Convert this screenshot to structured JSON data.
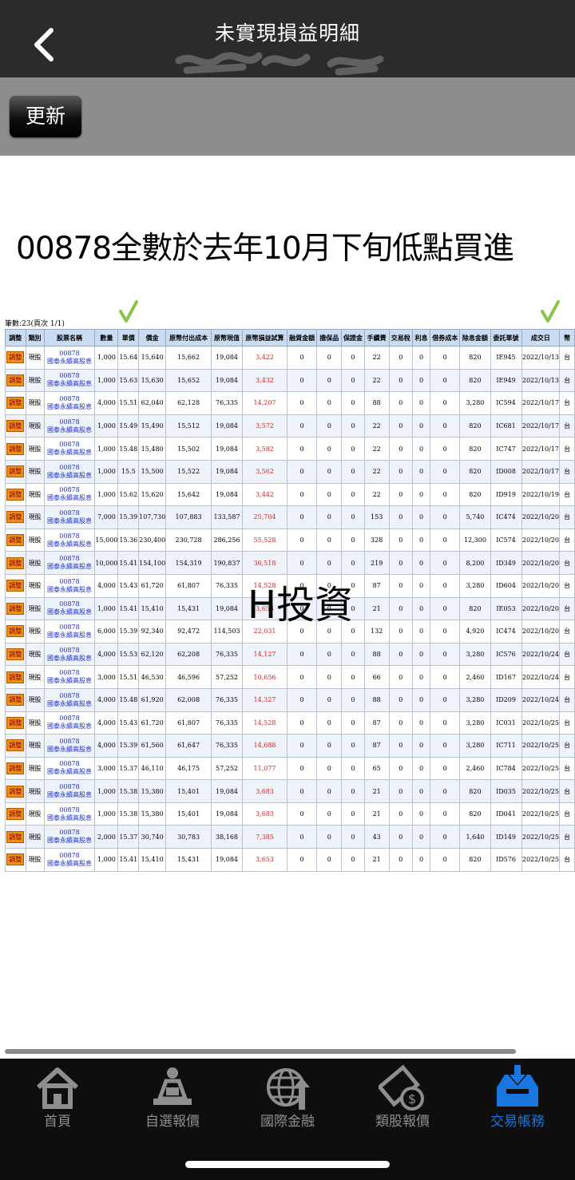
{
  "header": {
    "title": "未實現損益明細"
  },
  "toolbar": {
    "refresh_label": "更新"
  },
  "headline": "00878全數於去年10月下旬低點買進",
  "record_count": "筆數:23(頁次 1/1)",
  "watermark": "H投資",
  "table": {
    "columns": [
      "調整",
      "類別",
      "股票名稱",
      "數量",
      "單價",
      "價金",
      "原幣付出成本",
      "原幣現值",
      "原幣損益試算",
      "融資金額",
      "擔保品",
      "保證金",
      "手續費",
      "交易稅",
      "利息",
      "借券成本",
      "除息金額",
      "委託單號",
      "成交日",
      "幣"
    ],
    "adjust_label": "調整",
    "rows": [
      [
        "現股",
        "00878",
        "國泰永續高股息",
        "1,000",
        "15.64",
        "15,640",
        "15,662",
        "19,084",
        "3,422",
        "0",
        "0",
        "0",
        "22",
        "0",
        "0",
        "0",
        "820",
        "IE945",
        "2022/10/13",
        "台"
      ],
      [
        "現股",
        "00878",
        "國泰永續高股息",
        "1,000",
        "15.63",
        "15,630",
        "15,652",
        "19,084",
        "3,432",
        "0",
        "0",
        "0",
        "22",
        "0",
        "0",
        "0",
        "820",
        "IE949",
        "2022/10/13",
        "台"
      ],
      [
        "現股",
        "00878",
        "國泰永續高股息",
        "4,000",
        "15.51",
        "62,040",
        "62,128",
        "76,335",
        "14,207",
        "0",
        "0",
        "0",
        "88",
        "0",
        "0",
        "0",
        "3,280",
        "IC594",
        "2022/10/17",
        "台"
      ],
      [
        "現股",
        "00878",
        "國泰永續高股息",
        "1,000",
        "15.49",
        "15,490",
        "15,512",
        "19,084",
        "3,572",
        "0",
        "0",
        "0",
        "22",
        "0",
        "0",
        "0",
        "820",
        "IC681",
        "2022/10/17",
        "台"
      ],
      [
        "現股",
        "00878",
        "國泰永續高股息",
        "1,000",
        "15.48",
        "15,480",
        "15,502",
        "19,084",
        "3,582",
        "0",
        "0",
        "0",
        "22",
        "0",
        "0",
        "0",
        "820",
        "IC747",
        "2022/10/17",
        "台"
      ],
      [
        "現股",
        "00878",
        "國泰永續高股息",
        "1,000",
        "15.5",
        "15,500",
        "15,522",
        "19,084",
        "3,562",
        "0",
        "0",
        "0",
        "22",
        "0",
        "0",
        "0",
        "820",
        "ID008",
        "2022/10/17",
        "台"
      ],
      [
        "現股",
        "00878",
        "國泰永續高股息",
        "1,000",
        "15.62",
        "15,620",
        "15,642",
        "19,084",
        "3,442",
        "0",
        "0",
        "0",
        "22",
        "0",
        "0",
        "0",
        "820",
        "ID919",
        "2022/10/19",
        "台"
      ],
      [
        "現股",
        "00878",
        "國泰永續高股息",
        "7,000",
        "15.39",
        "107,730",
        "107,883",
        "133,587",
        "25,704",
        "0",
        "0",
        "0",
        "153",
        "0",
        "0",
        "0",
        "5,740",
        "IC474",
        "2022/10/20",
        "台"
      ],
      [
        "現股",
        "00878",
        "國泰永續高股息",
        "15,000",
        "15.36",
        "230,400",
        "230,728",
        "286,256",
        "55,528",
        "0",
        "0",
        "0",
        "328",
        "0",
        "0",
        "0",
        "12,300",
        "IC574",
        "2022/10/20",
        "台"
      ],
      [
        "現股",
        "00878",
        "國泰永續高股息",
        "10,000",
        "15.41",
        "154,100",
        "154,319",
        "190,837",
        "36,518",
        "0",
        "0",
        "0",
        "219",
        "0",
        "0",
        "0",
        "8,200",
        "ID349",
        "2022/10/20",
        "台"
      ],
      [
        "現股",
        "00878",
        "國泰永續高股息",
        "4,000",
        "15.43",
        "61,720",
        "61,807",
        "76,335",
        "14,528",
        "0",
        "0",
        "0",
        "87",
        "0",
        "0",
        "0",
        "3,280",
        "ID604",
        "2022/10/20",
        "台"
      ],
      [
        "現股",
        "00878",
        "國泰永續高股息",
        "1,000",
        "15.41",
        "15,410",
        "15,431",
        "19,084",
        "3,653",
        "0",
        "0",
        "0",
        "21",
        "0",
        "0",
        "0",
        "820",
        "IE053",
        "2022/10/20",
        "台"
      ],
      [
        "現股",
        "00878",
        "國泰永續高股息",
        "6,000",
        "15.39",
        "92,340",
        "92,472",
        "114,503",
        "22,031",
        "0",
        "0",
        "0",
        "132",
        "0",
        "0",
        "0",
        "4,920",
        "IC474",
        "2022/10/20",
        "台"
      ],
      [
        "現股",
        "00878",
        "國泰永續高股息",
        "4,000",
        "15.53",
        "62,120",
        "62,208",
        "76,335",
        "14,127",
        "0",
        "0",
        "0",
        "88",
        "0",
        "0",
        "0",
        "3,280",
        "IC576",
        "2022/10/24",
        "台"
      ],
      [
        "現股",
        "00878",
        "國泰永續高股息",
        "3,000",
        "15.51",
        "46,530",
        "46,596",
        "57,252",
        "10,656",
        "0",
        "0",
        "0",
        "66",
        "0",
        "0",
        "0",
        "2,460",
        "ID167",
        "2022/10/24",
        "台"
      ],
      [
        "現股",
        "00878",
        "國泰永續高股息",
        "4,000",
        "15.48",
        "61,920",
        "62,008",
        "76,335",
        "14,327",
        "0",
        "0",
        "0",
        "88",
        "0",
        "0",
        "0",
        "3,280",
        "ID209",
        "2022/10/24",
        "台"
      ],
      [
        "現股",
        "00878",
        "國泰永續高股息",
        "4,000",
        "15.43",
        "61,720",
        "61,807",
        "76,335",
        "14,528",
        "0",
        "0",
        "0",
        "87",
        "0",
        "0",
        "0",
        "3,280",
        "IC031",
        "2022/10/25",
        "台"
      ],
      [
        "現股",
        "00878",
        "國泰永續高股息",
        "4,000",
        "15.39",
        "61,560",
        "61,647",
        "76,335",
        "14,688",
        "0",
        "0",
        "0",
        "87",
        "0",
        "0",
        "0",
        "3,280",
        "IC711",
        "2022/10/25",
        "台"
      ],
      [
        "現股",
        "00878",
        "國泰永續高股息",
        "3,000",
        "15.37",
        "46,110",
        "46,175",
        "57,252",
        "11,077",
        "0",
        "0",
        "0",
        "65",
        "0",
        "0",
        "0",
        "2,460",
        "IC784",
        "2022/10/25",
        "台"
      ],
      [
        "現股",
        "00878",
        "國泰永續高股息",
        "1,000",
        "15.38",
        "15,380",
        "15,401",
        "19,084",
        "3,683",
        "0",
        "0",
        "0",
        "21",
        "0",
        "0",
        "0",
        "820",
        "ID035",
        "2022/10/25",
        "台"
      ],
      [
        "現股",
        "00878",
        "國泰永續高股息",
        "1,000",
        "15.38",
        "15,380",
        "15,401",
        "19,084",
        "3,683",
        "0",
        "0",
        "0",
        "21",
        "0",
        "0",
        "0",
        "820",
        "ID041",
        "2022/10/25",
        "台"
      ],
      [
        "現股",
        "00878",
        "國泰永續高股息",
        "2,000",
        "15.37",
        "30,740",
        "30,783",
        "38,168",
        "7,385",
        "0",
        "0",
        "0",
        "43",
        "0",
        "0",
        "0",
        "1,640",
        "ID149",
        "2022/10/25",
        "台"
      ],
      [
        "現股",
        "00878",
        "國泰永續高股息",
        "1,000",
        "15.41",
        "15,410",
        "15,431",
        "19,084",
        "3,653",
        "0",
        "0",
        "0",
        "21",
        "0",
        "0",
        "0",
        "820",
        "ID576",
        "2022/10/25",
        "台"
      ]
    ]
  },
  "tabs": [
    {
      "label": "首頁",
      "icon": "home-icon",
      "active": false
    },
    {
      "label": "自選報價",
      "icon": "trader-icon",
      "active": false
    },
    {
      "label": "國際金融",
      "icon": "globe-icon",
      "active": false
    },
    {
      "label": "類股報價",
      "icon": "film-dollar-icon",
      "active": false
    },
    {
      "label": "交易帳務",
      "icon": "tray-download-icon",
      "active": true
    }
  ],
  "colors": {
    "active_tab": "#1976e0",
    "loss_gain_text": "#e02020",
    "checkmark": "#8bc34a"
  }
}
